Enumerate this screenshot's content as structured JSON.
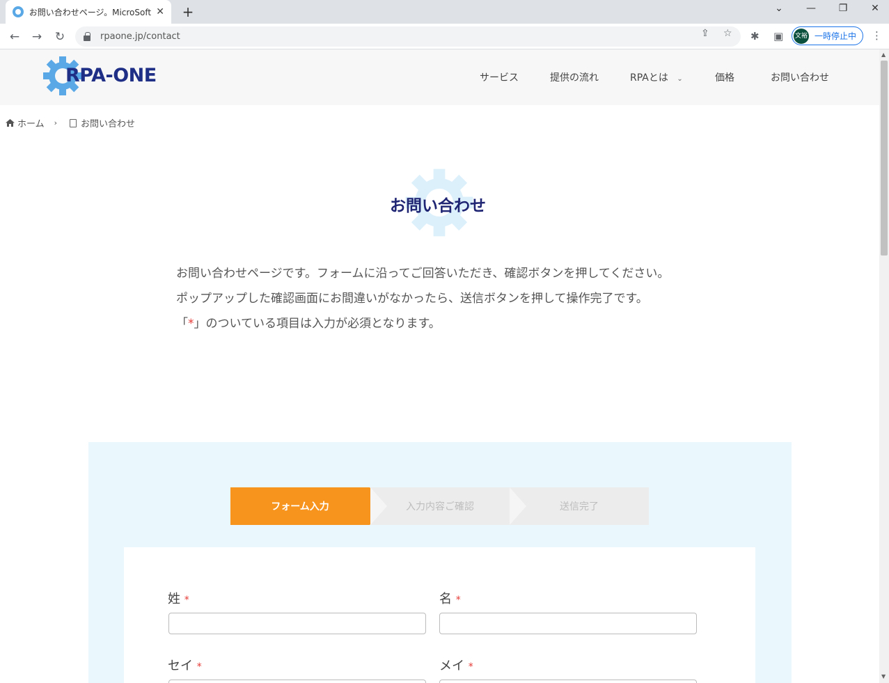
{
  "browser": {
    "tab_title": "お問い合わせページ。MicroSoftのRPA",
    "url": "rpaone.jp/contact",
    "profile_avatar": "文裕",
    "profile_label": "一時停止中"
  },
  "header": {
    "logo_text": "RPA-ONE",
    "nav": [
      {
        "label": "サービス"
      },
      {
        "label": "提供の流れ"
      },
      {
        "label": "RPAとは"
      },
      {
        "label": "価格"
      },
      {
        "label": "お問い合わせ"
      }
    ]
  },
  "breadcrumb": {
    "home": "ホーム",
    "current": "お問い合わせ"
  },
  "page": {
    "title": "お問い合わせ",
    "intro_line1": "お問い合わせページです。フォームに沿ってご回答いただき、確認ボタンを押してください。",
    "intro_line2": "ポップアップした確認画面にお間違いがなかったら、送信ボタンを押して操作完了です。",
    "intro_line3_pre": "「",
    "intro_line3_mark": "*",
    "intro_line3_post": "」のついている項目は入力が必須となります。"
  },
  "steps": [
    {
      "label": "フォーム入力"
    },
    {
      "label": "入力内容ご確認"
    },
    {
      "label": "送信完了"
    }
  ],
  "form": {
    "required_mark": "*",
    "fields": [
      {
        "label": "姓",
        "value": ""
      },
      {
        "label": "名",
        "value": ""
      },
      {
        "label": "セイ",
        "value": ""
      },
      {
        "label": "メイ",
        "value": ""
      }
    ]
  },
  "colors": {
    "accent": "#f7941d",
    "brand": "#1f2f86",
    "panel_bg": "#eaf8fe",
    "required": "#e53935"
  }
}
